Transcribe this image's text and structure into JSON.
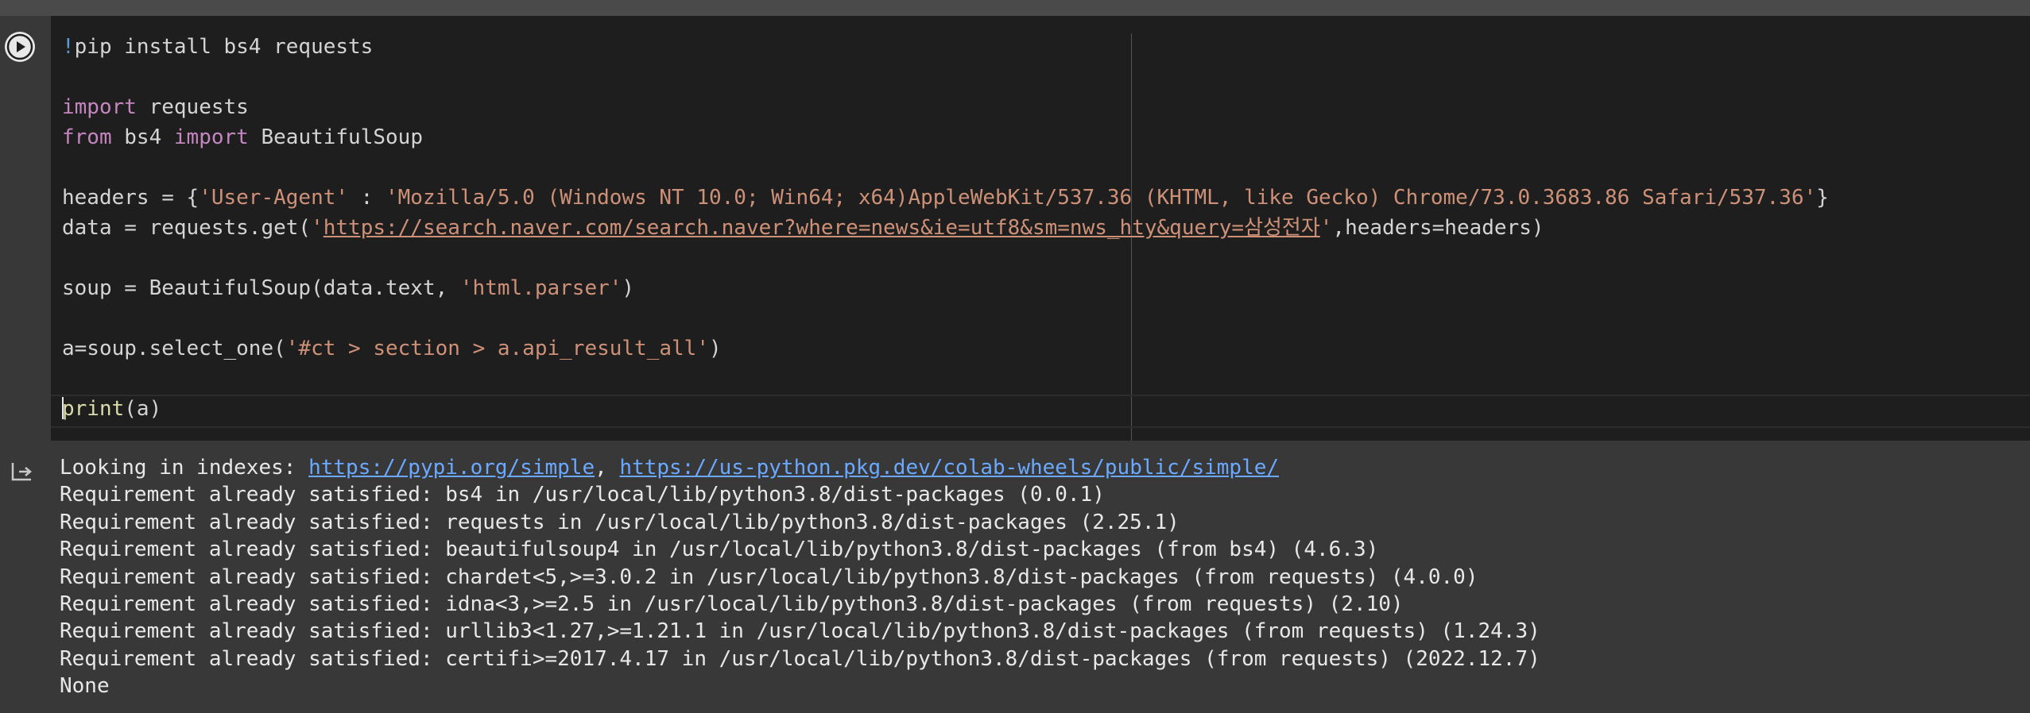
{
  "cell": {
    "run_button": "run-cell",
    "code": {
      "l1_bang": "!",
      "l1_text": "pip install bs4 requests",
      "l3_kw": "import",
      "l3_rest": " requests",
      "l4_kw1": "from",
      "l4_mid": " bs4 ",
      "l4_kw2": "import",
      "l4_rest": " BeautifulSoup",
      "l6_pre": "headers = {",
      "l6_key": "'User-Agent'",
      "l6_colon": " : ",
      "l6_val": "'Mozilla/5.0 (Windows NT 10.0; Win64; x64)AppleWebKit/537.36 (KHTML, like Gecko) Chrome/73.0.3683.86 Safari/537.36'",
      "l6_end": "}",
      "l7_pre": "data = requests.get(",
      "l7_q1": "'",
      "l7_url": "https://search.naver.com/search.naver?where=news&ie=utf8&sm=nws_hty&query=삼성전자",
      "l7_q2": "'",
      "l7_end": ",headers=headers)",
      "l9_pre": "soup = BeautifulSoup(data.text, ",
      "l9_str": "'html.parser'",
      "l9_end": ")",
      "l11_pre": "a=soup.select_one(",
      "l11_str": "'#ct > section > a.api_result_all'",
      "l11_end": ")",
      "l13_fn": "print",
      "l13_rest": "(a)"
    }
  },
  "output": {
    "l1_pre": "Looking in indexes: ",
    "l1_link1": "https://pypi.org/simple",
    "l1_sep": ", ",
    "l1_link2": "https://us-python.pkg.dev/colab-wheels/public/simple/",
    "lines": [
      "Requirement already satisfied: bs4 in /usr/local/lib/python3.8/dist-packages (0.0.1)",
      "Requirement already satisfied: requests in /usr/local/lib/python3.8/dist-packages (2.25.1)",
      "Requirement already satisfied: beautifulsoup4 in /usr/local/lib/python3.8/dist-packages (from bs4) (4.6.3)",
      "Requirement already satisfied: chardet<5,>=3.0.2 in /usr/local/lib/python3.8/dist-packages (from requests) (4.0.0)",
      "Requirement already satisfied: idna<3,>=2.5 in /usr/local/lib/python3.8/dist-packages (from requests) (2.10)",
      "Requirement already satisfied: urllib3<1.27,>=1.21.1 in /usr/local/lib/python3.8/dist-packages (from requests) (1.24.3)",
      "Requirement already satisfied: certifi>=2017.4.17 in /usr/local/lib/python3.8/dist-packages (from requests) (2022.12.7)",
      "None"
    ]
  },
  "icons": {
    "run": "play-icon",
    "output": "output-arrow-icon"
  }
}
